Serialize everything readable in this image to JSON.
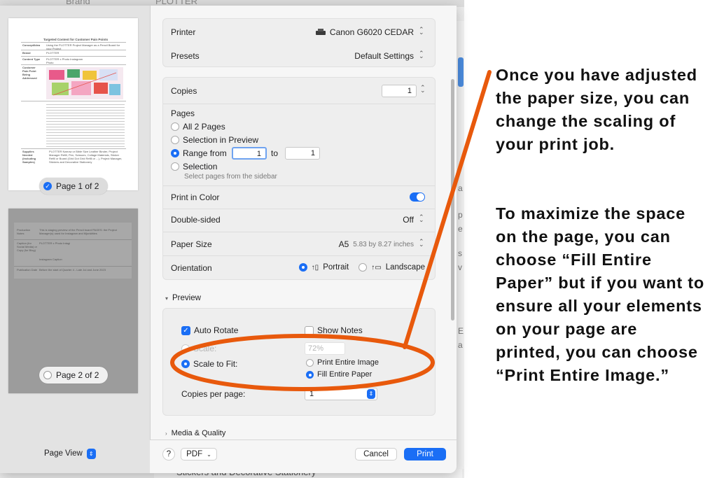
{
  "background": {
    "top_left_text": "Brand",
    "top_right_text": "PLOTTER",
    "bottom_text": "-   Stickers and Decorative Stationery",
    "right_peek_chars": [
      "a",
      "p",
      "e",
      "s",
      "v",
      "E",
      "a"
    ]
  },
  "sidebar": {
    "thumb1": {
      "title": "Targeted Content for Customer Pain Points",
      "rows": [
        {
          "label": "Concept/Idea",
          "value": "Using the PLOTTER Project Manager as a Pencil Board for your Project"
        },
        {
          "label": "Brand",
          "value": "PLOTTER"
        },
        {
          "label": "Content Type",
          "value": "PLOTTER x Photo Instagram Photo"
        },
        {
          "label": "Customer Pain Point Being Addressed",
          "value": ""
        },
        {
          "label": "Supplies Needed (Including Samples)",
          "value": "PLOTTER Narrow or Bible Size Leather Binder, Project Manager Refill, Pen, Scissors, Collage Materials, Sticker Refill or Board (Grid Dot Grid Refill or ...), Project Manager, Stickers and Decorative Stationery"
        }
      ]
    },
    "page1_label": "Page 1 of 2",
    "thumb2": {
      "rows": [
        {
          "label": "Production Notes",
          "value": "This is staging preview of the Pencil board PAGES: the Project Manager(s) used for Instagram and Mjunkitties"
        },
        {
          "label": "Caption (for Social Media) or Copy (for Blog)",
          "value": "PLOTTER x Photo Intagi"
        },
        {
          "label": "Publication Date",
          "value": "Before the start of Quarter 4 - Late Jul and June 2023"
        }
      ],
      "extra": "Instagram Caption"
    },
    "page2_label": "Page 2 of 2",
    "page_view_label": "Page View"
  },
  "printer": {
    "label": "Printer",
    "value": "Canon G6020 CEDAR"
  },
  "presets": {
    "label": "Presets",
    "value": "Default Settings"
  },
  "copies": {
    "label": "Copies",
    "value": "1"
  },
  "pages": {
    "label": "Pages",
    "options": [
      "All 2 Pages",
      "Selection in Preview",
      "Range from",
      "Selection"
    ],
    "range_from": "1",
    "range_to_label": "to",
    "range_to": "1",
    "selection_note": "Select pages from the sidebar"
  },
  "print_in_color": {
    "label": "Print in Color",
    "on": true
  },
  "double_sided": {
    "label": "Double-sided",
    "value": "Off"
  },
  "paper_size": {
    "label": "Paper Size",
    "value": "A5",
    "dims": "5.83 by 8.27 inches"
  },
  "orientation": {
    "label": "Orientation",
    "portrait": "Portrait",
    "landscape": "Landscape"
  },
  "preview": {
    "section_label": "Preview",
    "auto_rotate": "Auto Rotate",
    "show_notes": "Show Notes",
    "scale_label": "Scale:",
    "scale_value": "72%",
    "scale_to_fit": "Scale to Fit:",
    "print_entire_image": "Print Entire Image",
    "fill_entire_paper": "Fill Entire Paper",
    "copies_per_page_label": "Copies per page:",
    "copies_per_page_value": "1"
  },
  "media_quality": {
    "label": "Media & Quality"
  },
  "footer": {
    "help": "?",
    "pdf": "PDF",
    "cancel": "Cancel",
    "print": "Print"
  },
  "annotation": {
    "paragraph1": "Once you have adjusted the paper size, you can change the scaling of your print job.",
    "paragraph2": "To maximize the space on the page, you can choose “Fill Entire Paper” but if you want to ensure all your elements on your page are printed, you can choose “Print Entire Image.”",
    "highlight_color": "#e8590c"
  }
}
